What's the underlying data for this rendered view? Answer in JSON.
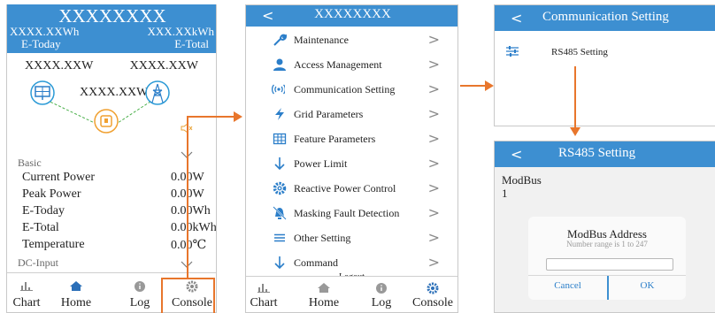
{
  "colors": {
    "header_blue": "#3d8fd1",
    "accent_orange": "#e8762c",
    "icon_blue": "#2b7ec9",
    "tab_gray": "#7d7d7d"
  },
  "panel1": {
    "title": "XXXXXXXX",
    "e_today_value": "XXXX.XXWh",
    "e_today_label": "E-Today",
    "e_total_value": "XXX.XXkWh",
    "e_total_label": "E-Total",
    "pv_power": "XXXX.XXW",
    "grid_power": "XXXX.XXW",
    "inverter_power": "XXXX.XXW",
    "basic_label": "Basic",
    "rows": [
      {
        "label": "Current Power",
        "value": "0.00W"
      },
      {
        "label": "Peak Power",
        "value": "0.00W"
      },
      {
        "label": "E-Today",
        "value": "0.00Wh"
      },
      {
        "label": "E-Total",
        "value": "0.00kWh"
      },
      {
        "label": "Temperature",
        "value": "0.00℃"
      }
    ],
    "dc_input_label": "DC-Input",
    "tabs": [
      "Chart",
      "Home",
      "Log",
      "Console"
    ]
  },
  "panel2": {
    "title": "XXXXXXXX",
    "back": "<",
    "menu": [
      {
        "label": "Maintenance",
        "icon": "wrench-icon"
      },
      {
        "label": "Access Management",
        "icon": "user-icon"
      },
      {
        "label": "Communication Setting",
        "icon": "signal-icon"
      },
      {
        "label": "Grid Parameters",
        "icon": "lightning-icon"
      },
      {
        "label": "Feature Parameters",
        "icon": "grid-table-icon"
      },
      {
        "label": "Power Limit",
        "icon": "arrow-down-icon"
      },
      {
        "label": "Reactive Power Control",
        "icon": "gear-icon"
      },
      {
        "label": "Masking Fault Detection",
        "icon": "bell-off-icon"
      },
      {
        "label": "Other Setting",
        "icon": "menu-lines-icon"
      },
      {
        "label": "Command",
        "icon": "arrow-down-icon"
      }
    ],
    "chevron": ">",
    "logout": "Logout",
    "tabs": [
      "Chart",
      "Home",
      "Log",
      "Console"
    ]
  },
  "panel3": {
    "back": "<",
    "title": "Communication Setting",
    "item": "RS485 Setting"
  },
  "panel4": {
    "back": "<",
    "title": "RS485 Setting",
    "field_label": "ModBus",
    "field_value": "1",
    "dialog": {
      "title": "ModBus Address",
      "hint": "Number range is 1 to 247",
      "input_value": "",
      "cancel": "Cancel",
      "ok": "OK"
    }
  }
}
